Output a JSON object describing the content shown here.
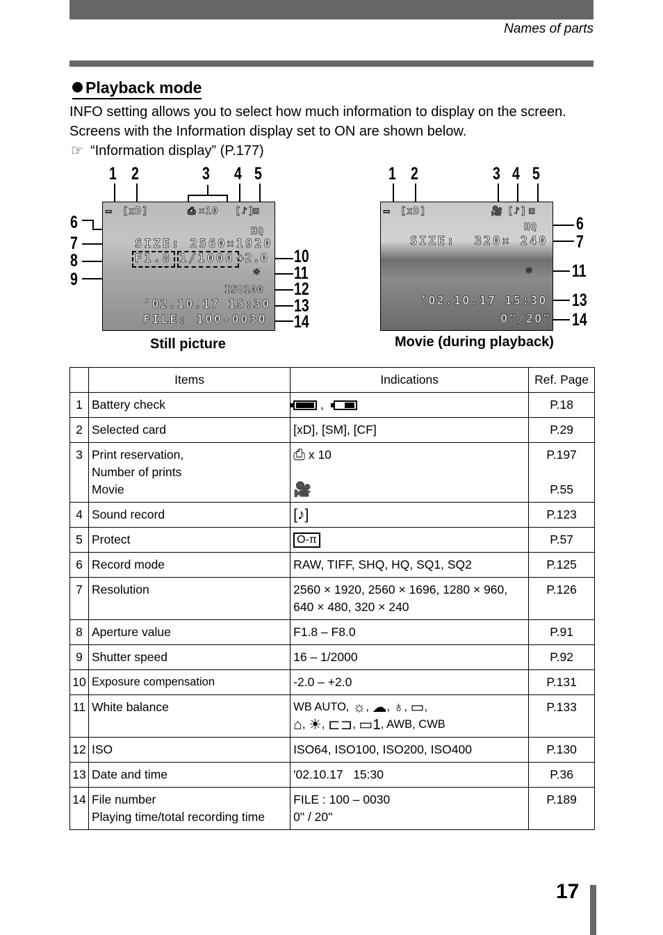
{
  "header": {
    "section": "Names of parts"
  },
  "section": {
    "title": "Playback mode",
    "intro": "INFO setting allows you to select how much information to display on the screen. Screens with the Information display set to ON are shown below.",
    "reference": "“Information display” (P.177)",
    "reference_icon": "pointing-hand-icon"
  },
  "still_picture": {
    "caption": "Still picture",
    "callouts": [
      "1",
      "2",
      "3",
      "4",
      "5",
      "6",
      "7",
      "8",
      "9",
      "10",
      "11",
      "12",
      "13",
      "14"
    ],
    "osd": {
      "card": "[xD]",
      "prints": "×10",
      "record_mode": "HQ",
      "size": "SIZE: 2560×1920",
      "aperture": "F1.8",
      "shutter": "1/1000",
      "exposure": "+2.0",
      "iso": "ISO100",
      "datetime": "’02.10.17  15:30",
      "file": "FILE: 100-0030"
    }
  },
  "movie": {
    "caption": "Movie (during playback)",
    "callouts": [
      "1",
      "2",
      "3",
      "4",
      "5",
      "6",
      "7",
      "11",
      "13",
      "14"
    ],
    "osd": {
      "card": "[xD]",
      "record_mode": "HQ",
      "size": "SIZE:  320× 240",
      "datetime": "’02.10.17  15:30",
      "time": "0\"/20\""
    }
  },
  "table": {
    "headers": [
      "",
      "Items",
      "Indications",
      "Ref. Page"
    ],
    "rows": [
      {
        "num": "1",
        "items": [
          "Battery check"
        ],
        "indications": [
          "battery-full-icon , battery-low-icon"
        ],
        "ref": [
          "P.18"
        ]
      },
      {
        "num": "2",
        "items": [
          "Selected card"
        ],
        "indications": [
          "[xD], [SM], [CF]"
        ],
        "ref": [
          "P.29"
        ]
      },
      {
        "num": "3",
        "items": [
          "Print reservation,",
          "Number of prints",
          "Movie"
        ],
        "indications": [
          "x 10",
          "movie-icon"
        ],
        "ref": [
          "P.197",
          "P.55"
        ]
      },
      {
        "num": "4",
        "items": [
          "Sound record"
        ],
        "indications": [
          "sound-record-icon"
        ],
        "ref": [
          "P.123"
        ]
      },
      {
        "num": "5",
        "items": [
          "Protect"
        ],
        "indications": [
          "protect-key-icon"
        ],
        "ref": [
          "P.57"
        ]
      },
      {
        "num": "6",
        "items": [
          "Record mode"
        ],
        "indications": [
          "RAW, TIFF, SHQ, HQ, SQ1, SQ2"
        ],
        "ref": [
          "P.125"
        ]
      },
      {
        "num": "7",
        "items": [
          "Resolution"
        ],
        "indications": [
          "2560 × 1920, 2560 × 1696, 1280 × 960,",
          "640 × 480, 320 × 240"
        ],
        "ref": [
          "P.126"
        ]
      },
      {
        "num": "8",
        "items": [
          "Aperture value"
        ],
        "indications": [
          "F1.8 – F8.0"
        ],
        "ref": [
          "P.91"
        ]
      },
      {
        "num": "9",
        "items": [
          "Shutter speed"
        ],
        "indications": [
          "16 – 1/2000"
        ],
        "ref": [
          "P.92"
        ]
      },
      {
        "num": "10",
        "items": [
          "Exposure compensation"
        ],
        "indications": [
          "-2.0 – +2.0"
        ],
        "ref": [
          "P.131"
        ]
      },
      {
        "num": "11",
        "items": [
          "White balance"
        ],
        "indications": [
          "WB AUTO,",
          ", AWB, CWB"
        ],
        "ref": [
          "P.133"
        ]
      },
      {
        "num": "12",
        "items": [
          "ISO"
        ],
        "indications": [
          "ISO64, ISO100, ISO200, ISO400"
        ],
        "ref": [
          "P.130"
        ]
      },
      {
        "num": "13",
        "items": [
          "Date and time"
        ],
        "indications": [
          "'02.10.17   15:30"
        ],
        "ref": [
          "P.36"
        ]
      },
      {
        "num": "14",
        "items": [
          "File number",
          "Playing time/total recording time"
        ],
        "indications": [
          "FILE : 100 – 0030",
          "0\" / 20\""
        ],
        "ref": [
          "P.189"
        ]
      }
    ]
  },
  "page_number": "17"
}
